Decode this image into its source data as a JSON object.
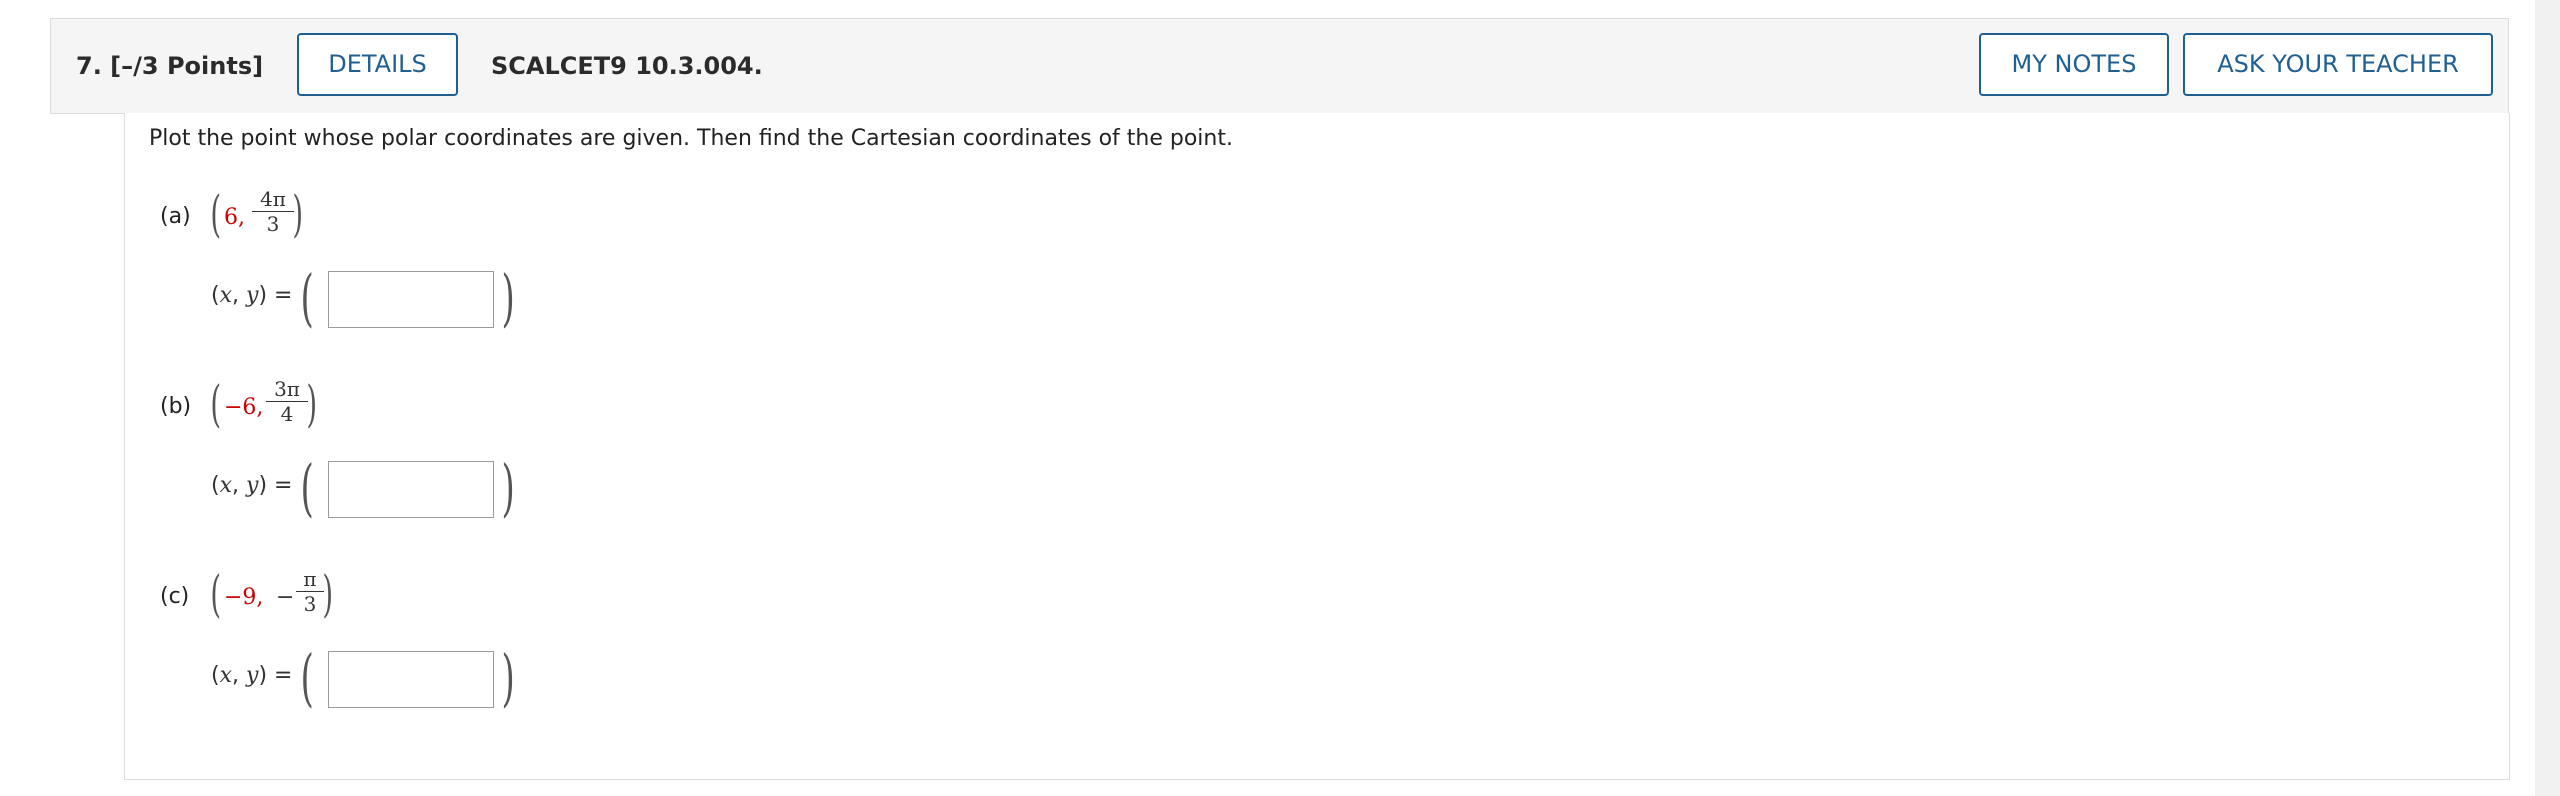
{
  "header": {
    "question_title": "7.  [–/3 Points]",
    "details_label": "DETAILS",
    "problem_code": "SCALCET9 10.3.004.",
    "my_notes_label": "MY NOTES",
    "ask_teacher_label": "ASK YOUR TEACHER"
  },
  "question": {
    "instructions": "Plot the point whose polar coordinates are given. Then find the Cartesian coordinates of the point.",
    "answer_label_x": "x",
    "answer_label_y": "y",
    "answer_eq": "=",
    "parts": [
      {
        "label": "(a)",
        "r": "6,",
        "sign": "",
        "theta_num": "4π",
        "theta_den": "3",
        "answer_value": "",
        "answer_placeholder": ""
      },
      {
        "label": "(b)",
        "r": "−6,",
        "sign": "",
        "theta_num": "3π",
        "theta_den": "4",
        "answer_value": "",
        "answer_placeholder": ""
      },
      {
        "label": "(c)",
        "r": "−9,",
        "sign": "−",
        "theta_num": "π",
        "theta_den": "3",
        "answer_value": "",
        "answer_placeholder": ""
      }
    ]
  },
  "colors": {
    "button_blue": "#1f5f93",
    "given_value_red": "#cc0000",
    "header_bg": "#f5f5f5"
  }
}
